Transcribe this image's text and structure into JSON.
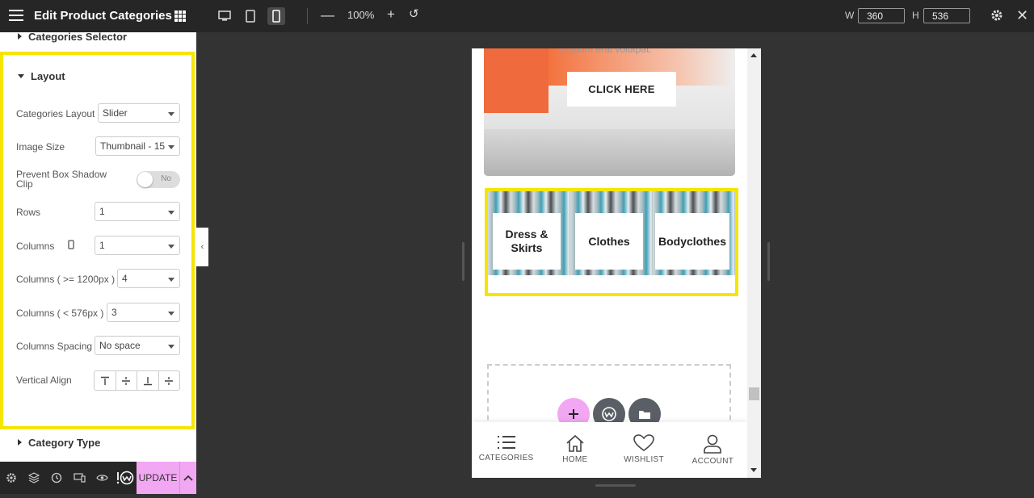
{
  "topbar": {
    "title": "Edit Product Categories",
    "zoom": "100%",
    "width_label": "W",
    "width_value": "360",
    "height_label": "H",
    "height_value": "536"
  },
  "panel": {
    "section_categories_selector": "Categories Selector",
    "section_layout": "Layout",
    "section_category_type": "Category Type",
    "fields": {
      "categories_layout": {
        "label": "Categories Layout",
        "value": "Slider"
      },
      "image_size": {
        "label": "Image Size",
        "value": "Thumbnail - 15"
      },
      "prevent_shadow": {
        "label": "Prevent Box Shadow Clip",
        "toggle": "No"
      },
      "rows": {
        "label": "Rows",
        "value": "1"
      },
      "columns": {
        "label": "Columns",
        "value": "1"
      },
      "columns_large": {
        "label": "Columns ( >= 1200px )",
        "value": "4"
      },
      "columns_small": {
        "label": "Columns ( < 576px )",
        "value": "3"
      },
      "columns_spacing": {
        "label": "Columns Spacing",
        "value": "No space"
      },
      "vertical_align": {
        "label": "Vertical Align"
      }
    },
    "update_label": "UPDATE"
  },
  "preview": {
    "faded_text": "aliquam erat volutpat.",
    "cta": "CLICK HERE",
    "categories": [
      "Dress & Skirts",
      "Clothes",
      "Bodyclothes"
    ],
    "nav": [
      {
        "label": "CATEGORIES",
        "icon": "list-icon"
      },
      {
        "label": "HOME",
        "icon": "home-icon"
      },
      {
        "label": "WISHLIST",
        "icon": "heart-icon"
      },
      {
        "label": "ACCOUNT",
        "icon": "user-icon"
      }
    ]
  },
  "colors": {
    "accent_yellow": "#f5e500",
    "update_pink": "#f2a7f3",
    "topbar_bg": "#262626",
    "canvas_bg": "#333333"
  }
}
